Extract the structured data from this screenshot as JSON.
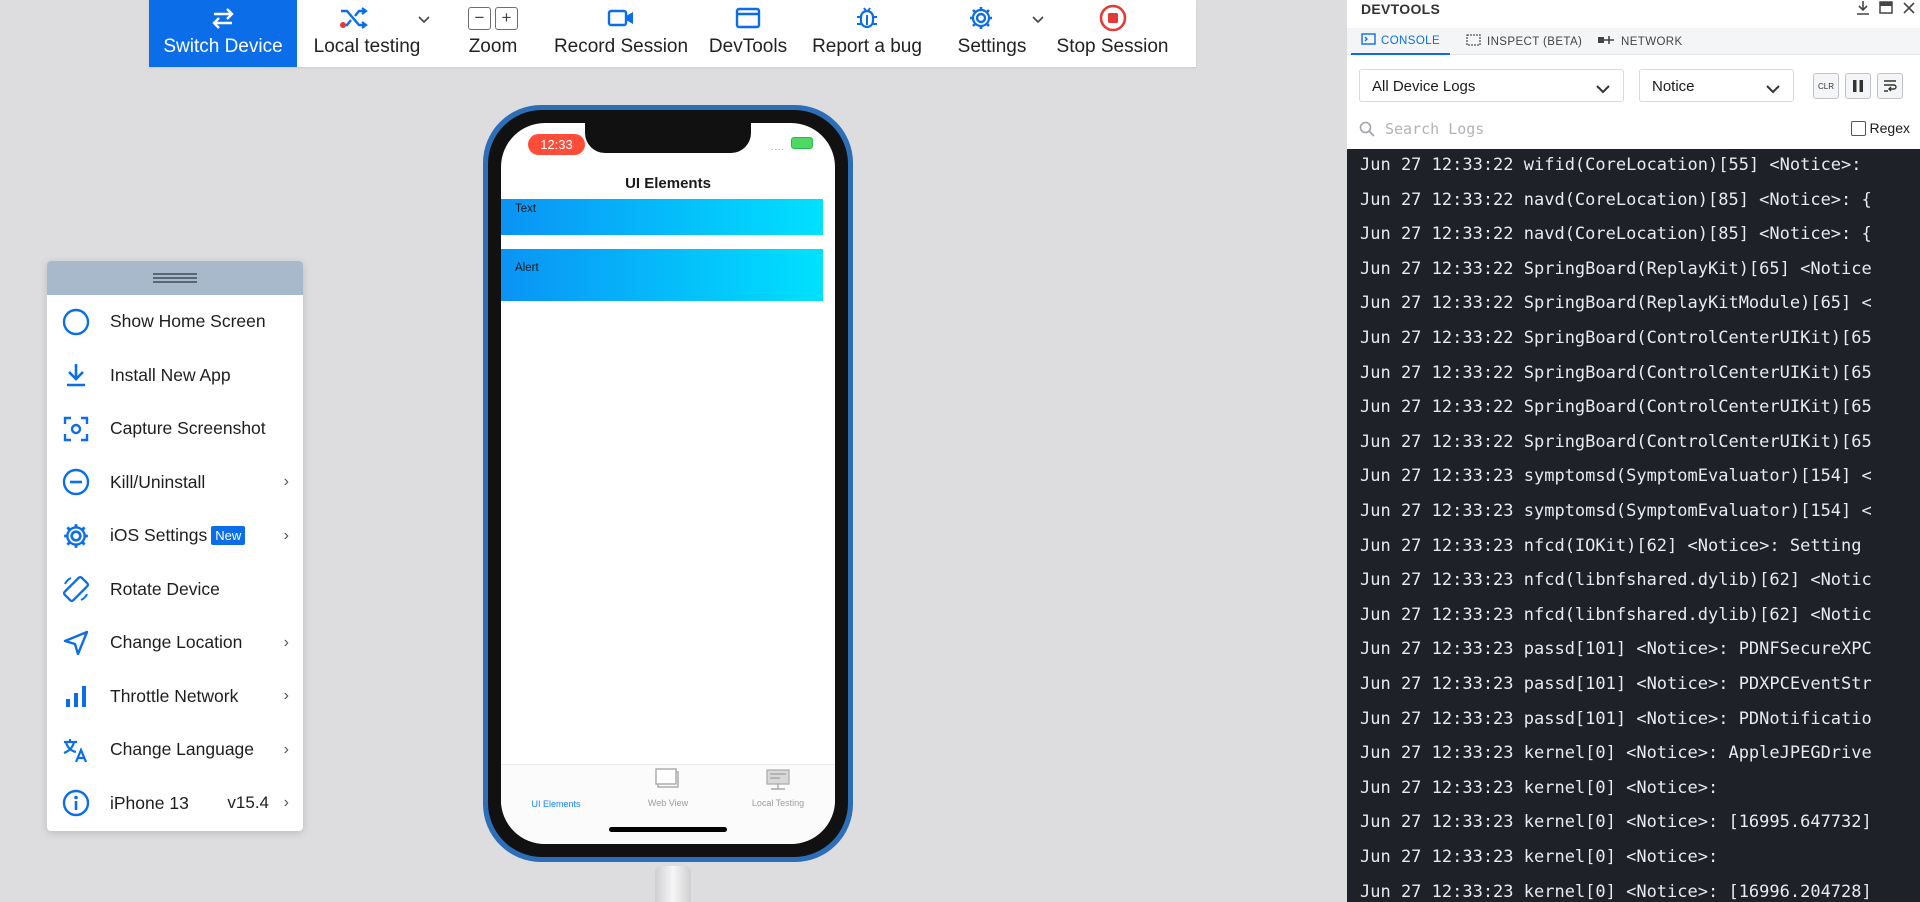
{
  "toolbar": {
    "switch_device": "Switch Device",
    "local_testing": "Local testing",
    "zoom": "Zoom",
    "zoom_minus": "−",
    "zoom_plus": "+",
    "record_session": "Record Session",
    "devtools": "DevTools",
    "report_bug": "Report a bug",
    "settings": "Settings",
    "stop_session": "Stop Session"
  },
  "side_menu": {
    "items": [
      {
        "label": "Show Home Screen",
        "icon": "circle-icon"
      },
      {
        "label": "Install New App",
        "icon": "download-icon"
      },
      {
        "label": "Capture Screenshot",
        "icon": "screenshot-icon"
      },
      {
        "label": "Kill/Uninstall",
        "icon": "minus-circle-icon"
      },
      {
        "label": "iOS Settings",
        "badge": "New",
        "icon": "gear-icon"
      },
      {
        "label": "Rotate Device",
        "icon": "rotate-icon"
      },
      {
        "label": "Change Location",
        "icon": "location-arrow-icon"
      },
      {
        "label": "Throttle Network",
        "icon": "signal-bars-icon"
      },
      {
        "label": "Change Language",
        "icon": "translate-icon"
      },
      {
        "label": "iPhone 13",
        "version": "v15.4",
        "icon": "info-icon"
      }
    ]
  },
  "phone": {
    "time": "12:33",
    "app_title": "UI Elements",
    "rows": [
      "Text",
      "Alert"
    ],
    "tabs": [
      "UI Elements",
      "Web View",
      "Local Testing"
    ]
  },
  "devtools": {
    "title": "DEVTOOLS",
    "tabs": [
      "CONSOLE",
      "INSPECT (BETA)",
      "NETWORK"
    ],
    "log_source": "All Device Logs",
    "log_level": "Notice",
    "clear_label": "CLR",
    "search_placeholder": "Search Logs",
    "regex_label": "Regex",
    "logs": [
      "Jun 27 12:33:22 wifid(CoreLocation)[55] <Notice>:",
      "Jun 27 12:33:22 navd(CoreLocation)[85] <Notice>: {",
      "Jun 27 12:33:22 navd(CoreLocation)[85] <Notice>: {",
      "Jun 27 12:33:22 SpringBoard(ReplayKit)[65] <Notice",
      "Jun 27 12:33:22 SpringBoard(ReplayKitModule)[65] <",
      "Jun 27 12:33:22 SpringBoard(ControlCenterUIKit)[65",
      "Jun 27 12:33:22 SpringBoard(ControlCenterUIKit)[65",
      "Jun 27 12:33:22 SpringBoard(ControlCenterUIKit)[65",
      "Jun 27 12:33:22 SpringBoard(ControlCenterUIKit)[65",
      "Jun 27 12:33:23 symptomsd(SymptomEvaluator)[154] <",
      "Jun 27 12:33:23 symptomsd(SymptomEvaluator)[154] <",
      "Jun 27 12:33:23 nfcd(IOKit)[62] <Notice>: Setting",
      "Jun 27 12:33:23 nfcd(libnfshared.dylib)[62] <Notic",
      "Jun 27 12:33:23 nfcd(libnfshared.dylib)[62] <Notic",
      "Jun 27 12:33:23 passd[101] <Notice>: PDNFSecureXPC",
      "Jun 27 12:33:23 passd[101] <Notice>: PDXPCEventStr",
      "Jun 27 12:33:23 passd[101] <Notice>: PDNotificatio",
      "Jun 27 12:33:23 kernel[0] <Notice>: AppleJPEGDrive",
      "Jun 27 12:33:23 kernel[0] <Notice>:",
      "Jun 27 12:33:23 kernel[0] <Notice>: [16995.647732]",
      "Jun 27 12:33:23 kernel[0] <Notice>:",
      "Jun 27 12:33:23 kernel[0] <Notice>: [16996.204728]"
    ]
  },
  "colors": {
    "accent": "#0b6ee8",
    "stop": "#e53935",
    "log_bg": "#1e2228",
    "status_pill": "#ff4d3a"
  }
}
